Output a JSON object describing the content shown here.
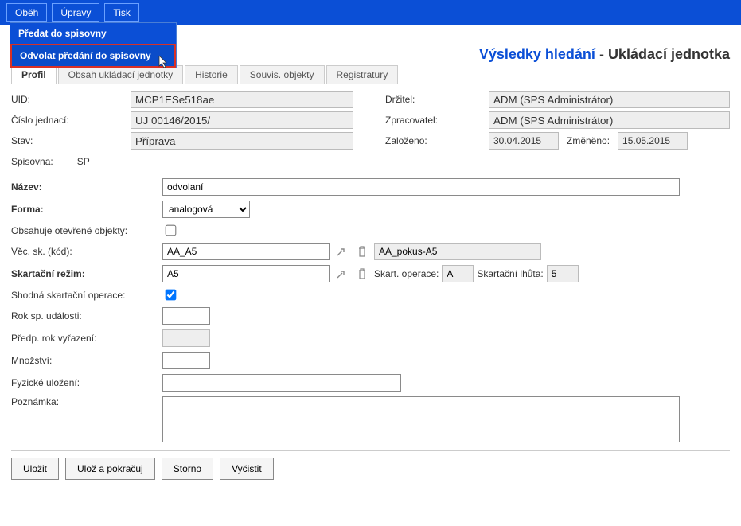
{
  "toolbar": {
    "obeh": "Oběh",
    "upravy": "Úpravy",
    "tisk": "Tisk"
  },
  "dropdown": {
    "item1": "Předat do spisovny",
    "item2": "Odvolat předání do spisovny"
  },
  "header": {
    "blue": "Výsledky hledání",
    "sep": " - ",
    "black": "Ukládací jednotka"
  },
  "tabs": {
    "profil": "Profil",
    "obsah": "Obsah ukládací jednotky",
    "historie": "Historie",
    "souvis": "Souvis. objekty",
    "registratury": "Registratury"
  },
  "topLabels": {
    "uid": "UID:",
    "cislo": "Číslo jednací:",
    "stav": "Stav:",
    "drzitel": "Držitel:",
    "zprac": "Zpracovatel:",
    "zalozeno": "Založeno:",
    "zmeneno": "Změněno:",
    "spisovna": "Spisovna:"
  },
  "topValues": {
    "uid": "MCP1ESe518ae",
    "cislo": "UJ 00146/2015/",
    "stav": "Příprava",
    "drzitel": "ADM (SPS Administrátor)",
    "zprac": "ADM (SPS Administrátor)",
    "zalozeno": "30.04.2015",
    "zmeneno": "15.05.2015",
    "spisovna": "SP"
  },
  "formLabels": {
    "nazev": "Název:",
    "forma": "Forma:",
    "obsahuje": "Obsahuje otevřené objekty:",
    "vecsk": "Věc. sk. (kód):",
    "skrez": "Skartační režim:",
    "skop": "Skart. operace:",
    "sklh": "Skartační lhůta:",
    "shodna": "Shodná skartační operace:",
    "roksp": "Rok sp. události:",
    "predp": "Předp. rok vyřazení:",
    "mnoz": "Množství:",
    "fyz": "Fyzické uložení:",
    "pozn": "Poznámka:"
  },
  "formValues": {
    "nazev": "odvolaní",
    "forma": "analogová",
    "vecsk_code": "AA_A5",
    "vecsk_name": "AA_pokus-A5",
    "skrez": "A5",
    "skop": "A",
    "sklh": "5",
    "roksp": "",
    "predp": "",
    "mnoz": "",
    "fyz": "",
    "pozn": ""
  },
  "buttons": {
    "ulozit": "Uložit",
    "ulozpokracuj": "Ulož a pokračuj",
    "storno": "Storno",
    "vycistit": "Vyčistit"
  }
}
